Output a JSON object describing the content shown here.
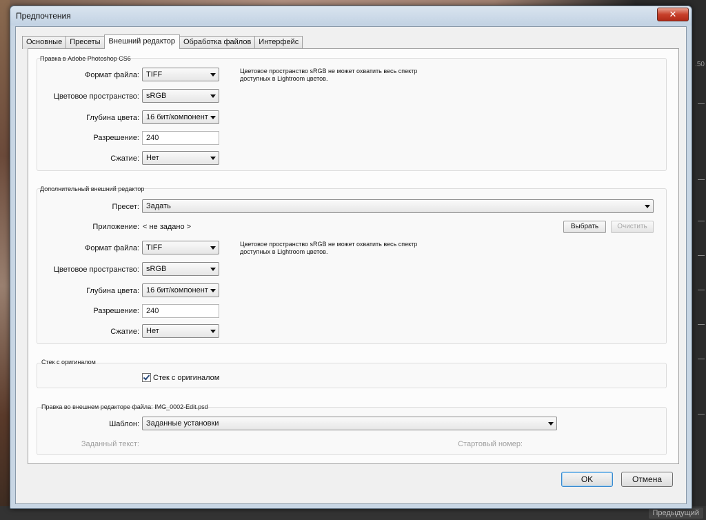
{
  "window": {
    "title": "Предпочтения",
    "close_glyph": "✕"
  },
  "tabs": [
    {
      "label": "Основные"
    },
    {
      "label": "Пресеты"
    },
    {
      "label": "Внешний редактор",
      "active": true
    },
    {
      "label": "Обработка файлов"
    },
    {
      "label": "Интерфейс"
    }
  ],
  "photoshop": {
    "title": "Правка в Adobe Photoshop CS6",
    "file_format_label": "Формат файла:",
    "file_format_value": "TIFF",
    "color_space_label": "Цветовое пространство:",
    "color_space_value": "sRGB",
    "bit_depth_label": "Глубина цвета:",
    "bit_depth_value": "16 бит/компонент",
    "resolution_label": "Разрешение:",
    "resolution_value": "240",
    "compression_label": "Сжатие:",
    "compression_value": "Нет",
    "note": "Цветовое пространство sRGB не может охватить весь спектр доступных в Lightroom цветов."
  },
  "additional": {
    "title": "Дополнительный внешний редактор",
    "preset_label": "Пресет:",
    "preset_value": "Задать",
    "app_label": "Приложение:",
    "app_value": "< не задано >",
    "choose_button": "Выбрать",
    "clear_button": "Очистить",
    "file_format_label": "Формат файла:",
    "file_format_value": "TIFF",
    "color_space_label": "Цветовое пространство:",
    "color_space_value": "sRGB",
    "bit_depth_label": "Глубина цвета:",
    "bit_depth_value": "16 бит/компонент",
    "resolution_label": "Разрешение:",
    "resolution_value": "240",
    "compression_label": "Сжатие:",
    "compression_value": "Нет",
    "note": "Цветовое пространство sRGB не может охватить весь спектр доступных в Lightroom цветов."
  },
  "stack": {
    "title": "Стек с оригиналом",
    "checkbox_label": "Стек с оригиналом",
    "checked": true
  },
  "naming": {
    "title": "Правка во внешнем редакторе файла:  IMG_0002-Edit.psd",
    "template_label": "Шаблон:",
    "template_value": "Заданные установки",
    "custom_text_label": "Заданный текст:",
    "start_number_label": "Стартовый номер:"
  },
  "footer": {
    "ok": "OK",
    "cancel": "Отмена"
  },
  "background": {
    "right_label": ".50",
    "bottom_label": "Предыдущий"
  },
  "colors": {
    "close_red": "#c7402a",
    "default_button_border": "#3a8ad0"
  }
}
